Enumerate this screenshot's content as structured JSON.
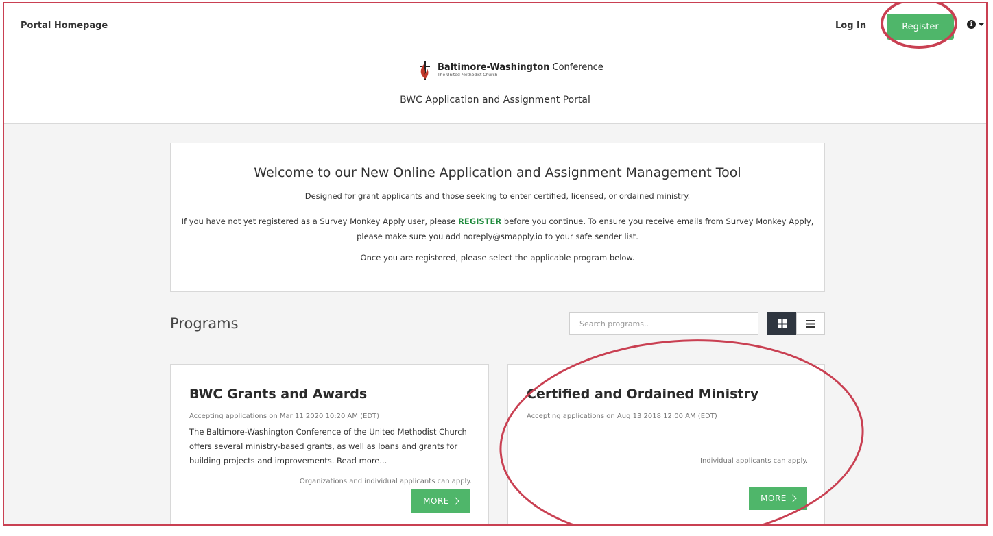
{
  "header": {
    "portal_home": "Portal Homepage",
    "login_label": "Log In",
    "register_label": "Register",
    "info_icon": "info-icon",
    "logo_name_bold": "Baltimore-Washington",
    "logo_name_rest": " Conference",
    "logo_subtitle": "The United Methodist Church",
    "portal_title": "BWC Application and Assignment Portal"
  },
  "welcome": {
    "heading": "Welcome to our New Online Application and Assignment Management Tool",
    "line1": "Designed for grant applicants and those seeking to enter certified, licensed, or ordained ministry.",
    "line2_before": "If you have not yet registered as a Survey Monkey Apply user, please ",
    "line2_link": "REGISTER",
    "line2_after": " before you continue.  To ensure you receive emails from Survey Monkey Apply, please make sure you add noreply@smapply.io to your safe sender list.",
    "line3": "Once you are registered, please select the applicable program below."
  },
  "programs": {
    "title": "Programs",
    "search_placeholder": "Search programs..",
    "view_grid_icon": "grid-view-icon",
    "view_list_icon": "list-view-icon",
    "cards": [
      {
        "title": "BWC Grants and Awards",
        "accepting": "Accepting applications on Mar 11 2020 10:20 AM (EDT)",
        "description": "The Baltimore-Washington Conference of the United Methodist Church offers several ministry-based grants, as well as loans and grants for building projects and improvements. Read more...",
        "who_can_apply": "Organizations and individual applicants can apply.",
        "more_label": "MORE"
      },
      {
        "title": "Certified and Ordained Ministry",
        "accepting": "Accepting applications on Aug 13 2018 12:00 AM (EDT)",
        "description": "",
        "who_can_apply": "Individual applicants can apply.",
        "more_label": "MORE"
      }
    ]
  },
  "colors": {
    "accent_green": "#4fb66a",
    "annotation_red": "#c94052",
    "dark": "#2f3640"
  }
}
